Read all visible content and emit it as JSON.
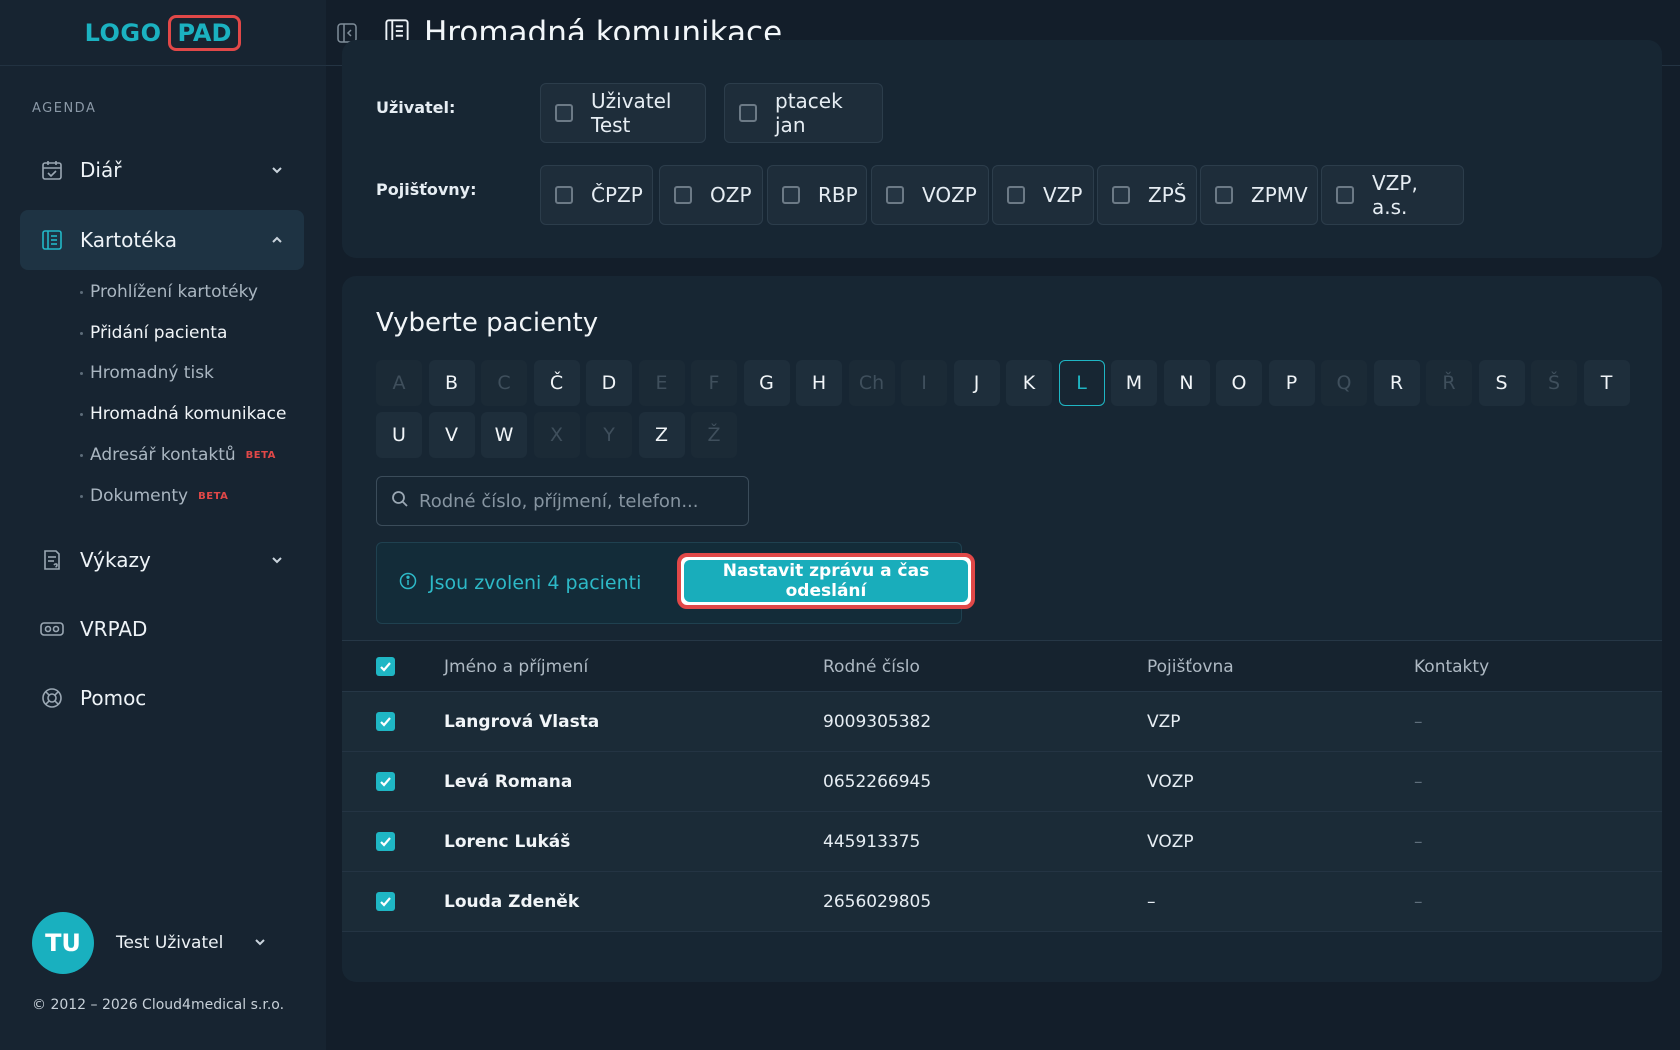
{
  "sidebar": {
    "logo": {
      "part1": "LOGO",
      "part2": "PAD"
    },
    "section": "AGENDA",
    "items": [
      {
        "label": "Diář",
        "icon": "calendar-icon"
      },
      {
        "label": "Kartotéka",
        "icon": "cardfile-icon"
      },
      {
        "label": "Výkazy",
        "icon": "report-icon"
      },
      {
        "label": "VRPAD",
        "icon": "vr-headset-icon"
      },
      {
        "label": "Pomoc",
        "icon": "lifebuoy-icon"
      }
    ],
    "subitems": [
      {
        "label": "Prohlížení kartotéky"
      },
      {
        "label": "Přidání pacienta"
      },
      {
        "label": "Hromadný tisk"
      },
      {
        "label": "Hromadná komunikace"
      },
      {
        "label": "Adresář kontaktů",
        "badge": "BETA"
      },
      {
        "label": "Dokumenty",
        "badge": "BETA"
      }
    ],
    "user": {
      "initials": "TU",
      "name": "Test Uživatel"
    },
    "copyright": "© 2012 – 2026 Cloud4medical s.r.o."
  },
  "header": {
    "title": "Hromadná komunikace"
  },
  "filters": {
    "user_label": "Uživatel:",
    "users": [
      "Uživatel Test",
      "ptacek jan"
    ],
    "insurers_label": "Pojišťovny:",
    "insurers": [
      "ČPZP",
      "OZP",
      "RBP",
      "VOZP",
      "VZP",
      "ZPŠ",
      "ZPMV",
      "VZP, a.s."
    ]
  },
  "patients": {
    "title": "Vyberte pacienty",
    "letters": [
      "A",
      "B",
      "C",
      "Č",
      "D",
      "E",
      "F",
      "G",
      "H",
      "Ch",
      "I",
      "J",
      "K",
      "L",
      "M",
      "N",
      "O",
      "P",
      "Q",
      "R",
      "Ř",
      "S",
      "Š",
      "T",
      "U",
      "V",
      "W",
      "X",
      "Y",
      "Z",
      "Ž"
    ],
    "disabled_letters": [
      "A",
      "C",
      "E",
      "F",
      "Ch",
      "I",
      "Q",
      "Ř",
      "Š",
      "X",
      "Y",
      "Ž"
    ],
    "selected_letter": "L",
    "search_placeholder": "Rodné číslo, příjmení, telefon...",
    "info_text": "Jsou zvoleni 4 pacienti",
    "action_button": "Nastavit zprávu a čas odeslání",
    "columns": [
      "Jméno a příjmení",
      "Rodné číslo",
      "Pojišťovna",
      "Kontakty"
    ],
    "rows": [
      {
        "name": "Langrová Vlasta",
        "rc": "9009305382",
        "insurer": "VZP",
        "contacts": "–"
      },
      {
        "name": "Levá Romana",
        "rc": "0652266945",
        "insurer": "VOZP",
        "contacts": "–"
      },
      {
        "name": "Lorenc Lukáš",
        "rc": "445913375",
        "insurer": "VOZP",
        "contacts": "–"
      },
      {
        "name": "Louda Zdeněk",
        "rc": "2656029805",
        "insurer": "–",
        "contacts": "–"
      }
    ]
  }
}
